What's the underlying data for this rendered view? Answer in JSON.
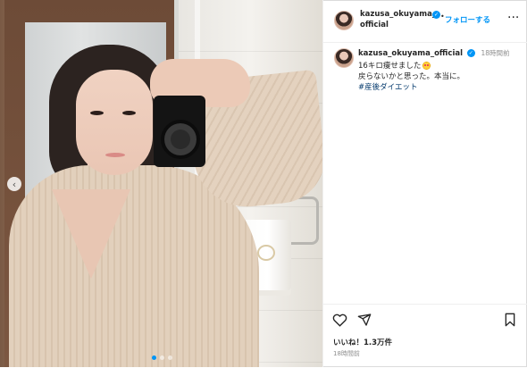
{
  "header": {
    "username_line1": "kazusa_okuyama_",
    "username_line2": "official",
    "follow_label": "フォローする",
    "more_label": "···"
  },
  "post": {
    "username": "kazusa_okuyama_official",
    "time": "18時間前",
    "caption_lines": [
      "16キロ痩せました",
      "戻らないかと思った。本当に。"
    ],
    "hashtag": "#産後ダイエット"
  },
  "footer": {
    "likes": "いいね！1.3万件",
    "time_ago": "18時間前"
  },
  "carousel": {
    "prev_label": "‹",
    "slide_count": 3,
    "active_index": 0
  },
  "colors": {
    "accent": "#0095f6",
    "hashtag": "#00376b",
    "muted": "#8e8e8e"
  },
  "icons": {
    "heart": "heart-icon",
    "share": "share-icon",
    "bookmark": "bookmark-icon",
    "verified": "verified-badge-icon",
    "more": "more-icon"
  }
}
